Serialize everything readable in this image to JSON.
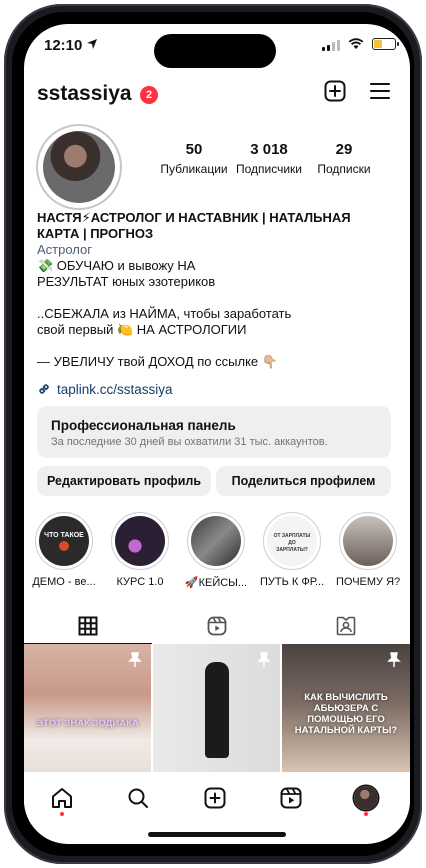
{
  "status": {
    "time": "12:10"
  },
  "header": {
    "username": "sstassiya",
    "notif_count": "2"
  },
  "stats": [
    {
      "value": "50",
      "label": "Публикации"
    },
    {
      "value": "3 018",
      "label": "Подписчики"
    },
    {
      "value": "29",
      "label": "Подписки"
    }
  ],
  "bio": {
    "name_line1": "НАСТЯ⚡АСТРОЛОГ И НАСТАВНИК | НАТАЛЬНАЯ",
    "name_line2": "КАРТА | ПРОГНОЗ",
    "category": "Астролог",
    "line1": "💸 ОБУЧАЮ и вывожу НА",
    "line2": "РЕЗУЛЬТАТ юных эзотериков",
    "line3": "..СБЕЖАЛА из НАЙМА, чтобы заработать",
    "line4": "свой первый 🍋 НА АСТРОЛОГИИ",
    "line5": "— УВЕЛИЧУ твой ДОХОД по ссылке 👇🏼",
    "link": "taplink.cc/sstassiya"
  },
  "pro_panel": {
    "title": "Профессиональная панель",
    "subtitle": "За последние 30 дней вы охватили 31 тыс. аккаунтов."
  },
  "buttons": {
    "edit": "Редактировать профиль",
    "share": "Поделиться профилем"
  },
  "highlights": [
    {
      "label": "ДЕМО - ве...",
      "cover_text": "ЧТО ТАКОЕ"
    },
    {
      "label": "КУРС 1.0",
      "cover_text": ""
    },
    {
      "label": "🚀КЕЙСЫ...",
      "cover_text": ""
    },
    {
      "label": "ПУТЬ К ФР...",
      "cover_text": "ОТ ЗАРПЛАТЫ ДО ЗАРПЛАТЫ?"
    },
    {
      "label": "ПОЧЕМУ Я?",
      "cover_text": ""
    }
  ],
  "posts": [
    {
      "caption": "ЭТОТ ЗНАК ЗОДИАКА"
    },
    {
      "caption": ""
    },
    {
      "caption": "КАК ВЫЧИСЛИТЬ АБЬЮЗЕРА С ПОМОЩЬЮ ЕГО НАТАЛЬНОЙ КАРТЫ?"
    }
  ],
  "colors": {
    "accent_red": "#ff3040",
    "link": "#163d6b",
    "panel_bg": "#efefef"
  }
}
